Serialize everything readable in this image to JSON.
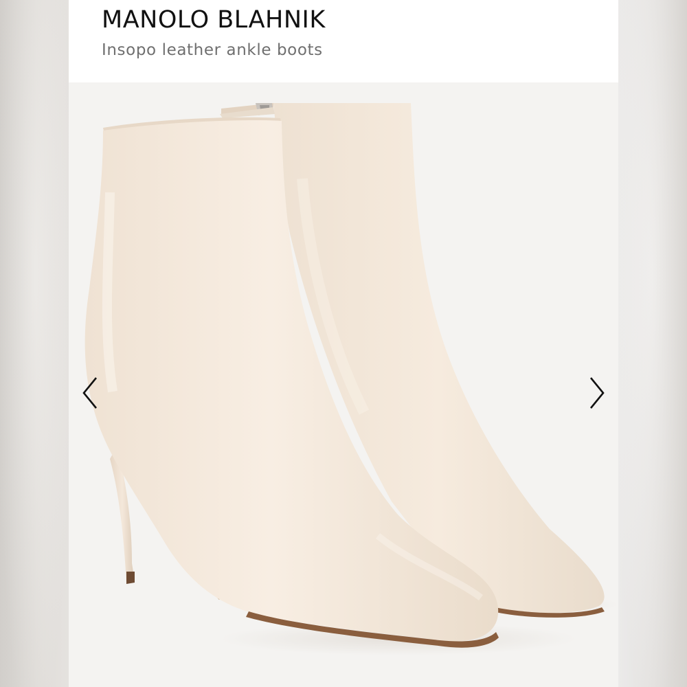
{
  "header": {
    "brand": "MANOLO BLAHNIK",
    "product_name": "Insopo leather ankle boots"
  },
  "gallery": {
    "product_colour": "#f3e6d8",
    "background_colour": "#f4f3f1",
    "previous_icon": "chevron-left-icon",
    "next_icon": "chevron-right-icon"
  }
}
